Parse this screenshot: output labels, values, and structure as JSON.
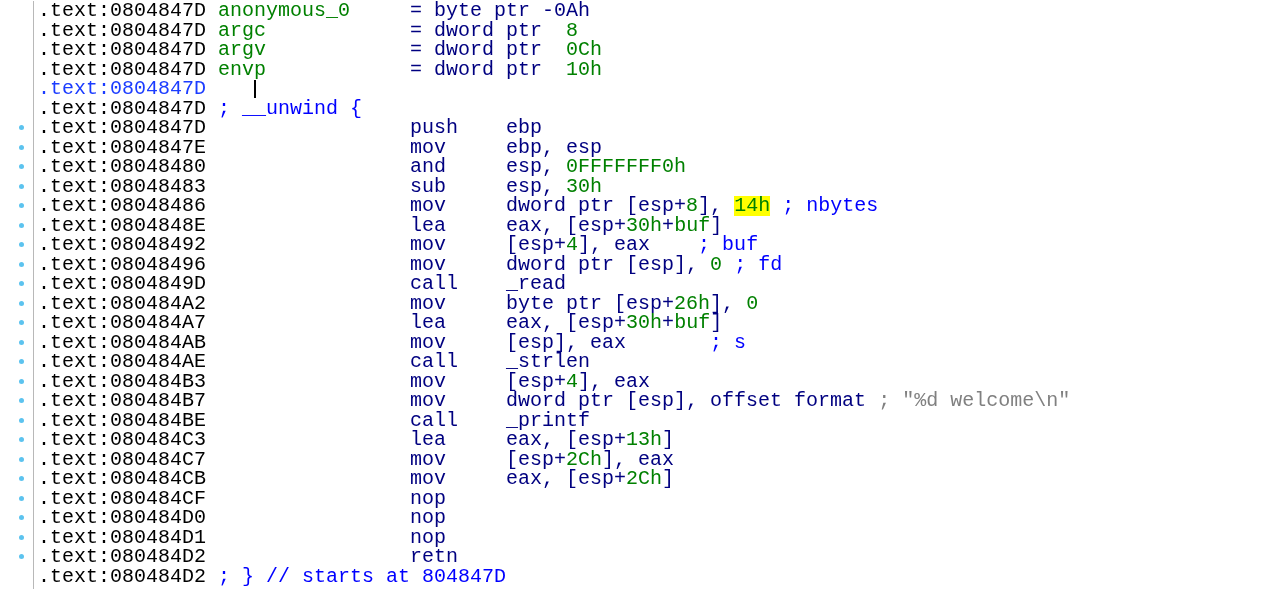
{
  "lines": [
    {
      "address": ".text:0804847D",
      "breakpoint_dot": false,
      "current": false,
      "label": "anonymous_0",
      "operands": [
        {
          "text": "= byte ptr -0Ah",
          "kind": "op"
        }
      ]
    },
    {
      "address": ".text:0804847D",
      "breakpoint_dot": false,
      "current": false,
      "label": "argc",
      "operands": [
        {
          "text": "= dword ptr  ",
          "kind": "op"
        },
        {
          "text": "8",
          "kind": "num"
        }
      ]
    },
    {
      "address": ".text:0804847D",
      "breakpoint_dot": false,
      "current": false,
      "label": "argv",
      "operands": [
        {
          "text": "= dword ptr  ",
          "kind": "op"
        },
        {
          "text": "0Ch",
          "kind": "num"
        }
      ]
    },
    {
      "address": ".text:0804847D",
      "breakpoint_dot": false,
      "current": false,
      "label": "envp",
      "operands": [
        {
          "text": "= dword ptr  ",
          "kind": "op"
        },
        {
          "text": "10h",
          "kind": "num"
        }
      ]
    },
    {
      "address": ".text:0804847D",
      "breakpoint_dot": false,
      "current": true,
      "caret": true
    },
    {
      "address": ".text:0804847D",
      "breakpoint_dot": false,
      "current": false,
      "note": "; __unwind {"
    },
    {
      "address": ".text:0804847D",
      "breakpoint_dot": true,
      "current": false,
      "mnemonic": "push",
      "operands": [
        {
          "text": "ebp",
          "kind": "op"
        }
      ]
    },
    {
      "address": ".text:0804847E",
      "breakpoint_dot": true,
      "current": false,
      "mnemonic": "mov",
      "operands": [
        {
          "text": "ebp, esp",
          "kind": "op"
        }
      ]
    },
    {
      "address": ".text:08048480",
      "breakpoint_dot": true,
      "current": false,
      "mnemonic": "and",
      "operands": [
        {
          "text": "esp, ",
          "kind": "op"
        },
        {
          "text": "0FFFFFFF0h",
          "kind": "num"
        }
      ]
    },
    {
      "address": ".text:08048483",
      "breakpoint_dot": true,
      "current": false,
      "mnemonic": "sub",
      "operands": [
        {
          "text": "esp, ",
          "kind": "op"
        },
        {
          "text": "30h",
          "kind": "num"
        }
      ]
    },
    {
      "address": ".text:08048486",
      "breakpoint_dot": true,
      "current": false,
      "mnemonic": "mov",
      "operands": [
        {
          "text": "dword ptr [esp+",
          "kind": "op"
        },
        {
          "text": "8",
          "kind": "num"
        },
        {
          "text": "], ",
          "kind": "op"
        },
        {
          "text": "14h",
          "kind": "num",
          "highlighted": true
        },
        {
          "text": " ; nbytes",
          "kind": "comment"
        }
      ]
    },
    {
      "address": ".text:0804848E",
      "breakpoint_dot": true,
      "current": false,
      "mnemonic": "lea",
      "operands": [
        {
          "text": "eax, [esp+",
          "kind": "op"
        },
        {
          "text": "30h",
          "kind": "num"
        },
        {
          "text": "+",
          "kind": "op"
        },
        {
          "text": "buf",
          "kind": "name"
        },
        {
          "text": "]",
          "kind": "op"
        }
      ]
    },
    {
      "address": ".text:08048492",
      "breakpoint_dot": true,
      "current": false,
      "mnemonic": "mov",
      "operands": [
        {
          "text": "[esp+",
          "kind": "op"
        },
        {
          "text": "4",
          "kind": "num"
        },
        {
          "text": "], eax",
          "kind": "op"
        },
        {
          "text": "    ; buf",
          "kind": "comment"
        }
      ]
    },
    {
      "address": ".text:08048496",
      "breakpoint_dot": true,
      "current": false,
      "mnemonic": "mov",
      "operands": [
        {
          "text": "dword ptr [esp], ",
          "kind": "op"
        },
        {
          "text": "0",
          "kind": "num"
        },
        {
          "text": " ; fd",
          "kind": "comment"
        }
      ]
    },
    {
      "address": ".text:0804849D",
      "breakpoint_dot": true,
      "current": false,
      "mnemonic": "call",
      "operands": [
        {
          "text": "_read",
          "kind": "op"
        }
      ]
    },
    {
      "address": ".text:080484A2",
      "breakpoint_dot": true,
      "current": false,
      "mnemonic": "mov",
      "operands": [
        {
          "text": "byte ptr [esp+",
          "kind": "op"
        },
        {
          "text": "26h",
          "kind": "num"
        },
        {
          "text": "], ",
          "kind": "op"
        },
        {
          "text": "0",
          "kind": "num"
        }
      ]
    },
    {
      "address": ".text:080484A7",
      "breakpoint_dot": true,
      "current": false,
      "mnemonic": "lea",
      "operands": [
        {
          "text": "eax, [esp+",
          "kind": "op"
        },
        {
          "text": "30h",
          "kind": "num"
        },
        {
          "text": "+",
          "kind": "op"
        },
        {
          "text": "buf",
          "kind": "name"
        },
        {
          "text": "]",
          "kind": "op"
        }
      ]
    },
    {
      "address": ".text:080484AB",
      "breakpoint_dot": true,
      "current": false,
      "mnemonic": "mov",
      "operands": [
        {
          "text": "[esp], eax",
          "kind": "op"
        },
        {
          "text": "       ; s",
          "kind": "comment"
        }
      ]
    },
    {
      "address": ".text:080484AE",
      "breakpoint_dot": true,
      "current": false,
      "mnemonic": "call",
      "operands": [
        {
          "text": "_strlen",
          "kind": "op"
        }
      ]
    },
    {
      "address": ".text:080484B3",
      "breakpoint_dot": true,
      "current": false,
      "mnemonic": "mov",
      "operands": [
        {
          "text": "[esp+",
          "kind": "op"
        },
        {
          "text": "4",
          "kind": "num"
        },
        {
          "text": "], eax",
          "kind": "op"
        }
      ]
    },
    {
      "address": ".text:080484B7",
      "breakpoint_dot": true,
      "current": false,
      "mnemonic": "mov",
      "operands": [
        {
          "text": "dword ptr [esp], offset format",
          "kind": "op"
        },
        {
          "text": " ; \"%d welcome\\n\"",
          "kind": "string"
        }
      ]
    },
    {
      "address": ".text:080484BE",
      "breakpoint_dot": true,
      "current": false,
      "mnemonic": "call",
      "operands": [
        {
          "text": "_printf",
          "kind": "op"
        }
      ]
    },
    {
      "address": ".text:080484C3",
      "breakpoint_dot": true,
      "current": false,
      "mnemonic": "lea",
      "operands": [
        {
          "text": "eax, [esp+",
          "kind": "op"
        },
        {
          "text": "13h",
          "kind": "num"
        },
        {
          "text": "]",
          "kind": "op"
        }
      ]
    },
    {
      "address": ".text:080484C7",
      "breakpoint_dot": true,
      "current": false,
      "mnemonic": "mov",
      "operands": [
        {
          "text": "[esp+",
          "kind": "op"
        },
        {
          "text": "2Ch",
          "kind": "num"
        },
        {
          "text": "], eax",
          "kind": "op"
        }
      ]
    },
    {
      "address": ".text:080484CB",
      "breakpoint_dot": true,
      "current": false,
      "mnemonic": "mov",
      "operands": [
        {
          "text": "eax, [esp+",
          "kind": "op"
        },
        {
          "text": "2Ch",
          "kind": "num"
        },
        {
          "text": "]",
          "kind": "op"
        }
      ]
    },
    {
      "address": ".text:080484CF",
      "breakpoint_dot": true,
      "current": false,
      "mnemonic": "nop"
    },
    {
      "address": ".text:080484D0",
      "breakpoint_dot": true,
      "current": false,
      "mnemonic": "nop"
    },
    {
      "address": ".text:080484D1",
      "breakpoint_dot": true,
      "current": false,
      "mnemonic": "nop"
    },
    {
      "address": ".text:080484D2",
      "breakpoint_dot": true,
      "current": false,
      "mnemonic": "retn"
    },
    {
      "address": ".text:080484D2",
      "breakpoint_dot": false,
      "current": false,
      "note": "; } // starts at 804847D"
    }
  ]
}
